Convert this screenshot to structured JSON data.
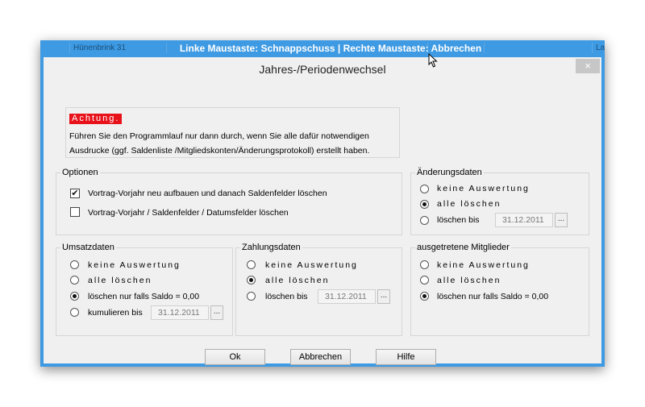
{
  "background_row": {
    "left_cell": "Hünenbrink 31",
    "right_cell": "La"
  },
  "banner": "Linke Maustaste: Schnappschuss | Rechte Maustaste: Abbrechen",
  "dialog": {
    "title": "Jahres-/Periodenwechsel",
    "close_glyph": "×",
    "warning": {
      "tag": "Achtung.",
      "line1": "Führen Sie den Programmlauf nur dann durch, wenn Sie alle dafür notwendigen",
      "line2": "Ausdrucke (ggf. Saldenliste /Mitgliedskonten/Änderungsprotokoll) erstellt haben."
    },
    "options": {
      "label": "Optionen",
      "items": [
        {
          "label": "Vortrag-Vorjahr neu aufbauen und danach Saldenfelder löschen",
          "checked": true
        },
        {
          "label": "Vortrag-Vorjahr / Saldenfelder / Datumsfelder löschen",
          "checked": false
        }
      ]
    },
    "aenderungsdaten": {
      "label": "Änderungsdaten",
      "opt1": "keine Auswertung",
      "opt2": "alle löschen",
      "opt3": "löschen bis",
      "selected": "alle löschen",
      "date": "31.12.2011"
    },
    "umsatzdaten": {
      "label": "Umsatzdaten",
      "opt1": "keine Auswertung",
      "opt2": "alle löschen",
      "opt3": "löschen nur falls Saldo = 0,00",
      "opt4": "kumulieren bis",
      "selected": "löschen nur falls Saldo = 0,00",
      "date": "31.12.2011"
    },
    "zahlungsdaten": {
      "label": "Zahlungsdaten",
      "opt1": "keine Auswertung",
      "opt2": "alle löschen",
      "opt3": "löschen bis",
      "selected": "alle löschen",
      "date": "31.12.2011"
    },
    "ausgetretene": {
      "label": "ausgetretene Mitglieder",
      "opt1": "keine Auswertung",
      "opt2": "alle löschen",
      "opt3": "löschen nur falls Saldo = 0,00",
      "selected": "löschen nur falls Saldo = 0,00"
    },
    "dots_label": "...",
    "buttons": {
      "ok": "Ok",
      "cancel": "Abbrechen",
      "help": "Hilfe"
    }
  },
  "colors": {
    "window_accent": "#3d9ae3",
    "warning_red": "#e8121b",
    "dialog_bg": "#f0f0f0"
  },
  "icons": [
    "close-icon",
    "checkbox-checked-icon",
    "radio-icon",
    "mouse-cursor-icon"
  ]
}
